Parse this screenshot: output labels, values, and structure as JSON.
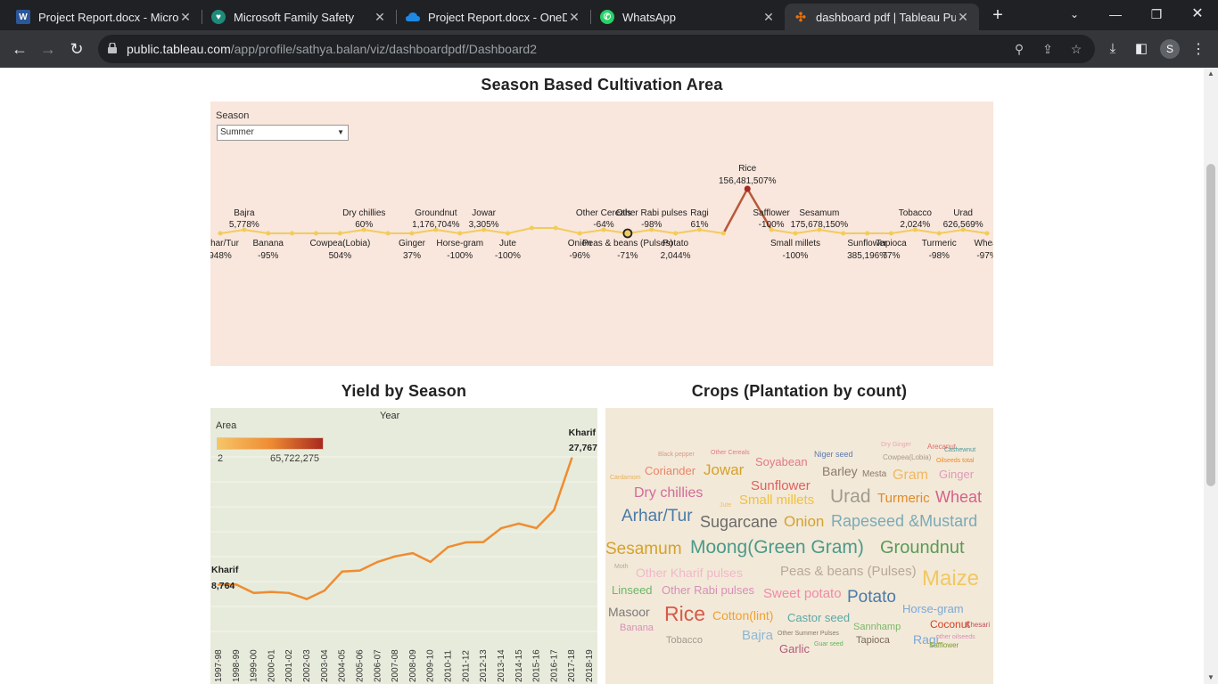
{
  "browser": {
    "tabs": [
      {
        "title": "Project Report.docx - Micros",
        "icon": "word-icon"
      },
      {
        "title": "Microsoft Family Safety",
        "icon": "family-safety-icon"
      },
      {
        "title": "Project Report.docx - OneDr",
        "icon": "onedrive-icon"
      },
      {
        "title": "WhatsApp",
        "icon": "whatsapp-icon"
      },
      {
        "title": "dashboard pdf | Tableau Pub",
        "icon": "tableau-icon",
        "active": true
      }
    ],
    "url_host": "public.tableau.com",
    "url_path": "/app/profile/sathya.balan/viz/dashboardpdf/Dashboard2",
    "profile_initial": "S"
  },
  "dashboard": {
    "season_title": "Season Based Cultivation Area",
    "season_filter_label": "Season",
    "season_filter_value": "Summer",
    "yield_title": "Yield by Season",
    "crops_title": "Crops (Plantation by count)",
    "yield_area_label": "Area",
    "yield_year_label": "Year",
    "yield_area_min": "2",
    "yield_area_max": "65,722,275"
  },
  "chart_data": [
    {
      "type": "line",
      "title": "Season Based Cultivation Area",
      "filter": "Summer",
      "points": [
        {
          "crop": "Arhar/Tur",
          "value": "948%",
          "pos": "below"
        },
        {
          "crop": "Bajra",
          "value": "5,778%",
          "pos": "above"
        },
        {
          "crop": "Banana",
          "value": "-95%",
          "pos": "below"
        },
        {
          "crop": "",
          "value": ""
        },
        {
          "crop": "",
          "value": ""
        },
        {
          "crop": "Cowpea(Lobia)",
          "value": "504%",
          "pos": "below"
        },
        {
          "crop": "Dry chillies",
          "value": "60%",
          "pos": "above"
        },
        {
          "crop": "",
          "value": ""
        },
        {
          "crop": "Ginger",
          "value": "37%",
          "pos": "below"
        },
        {
          "crop": "Groundnut",
          "value": "1,176,704%",
          "pos": "above"
        },
        {
          "crop": "Horse-gram",
          "value": "-100%",
          "pos": "below"
        },
        {
          "crop": "Jowar",
          "value": "3,305%",
          "pos": "above"
        },
        {
          "crop": "Jute",
          "value": "-100%",
          "pos": "below"
        },
        {
          "crop": "",
          "value": ""
        },
        {
          "crop": "",
          "value": ""
        },
        {
          "crop": "Onion",
          "value": "-96%",
          "pos": "below"
        },
        {
          "crop": "Other Cereals",
          "value": "-64%",
          "pos": "above"
        },
        {
          "crop": "Peas & beans (Pulses)",
          "value": "-71%",
          "pos": "below"
        },
        {
          "crop": "Other Rabi pulses",
          "value": "-98%",
          "pos": "above"
        },
        {
          "crop": "Potato",
          "value": "2,044%",
          "pos": "below"
        },
        {
          "crop": "Ragi",
          "value": "61%",
          "pos": "above"
        },
        {
          "crop": "",
          "value": ""
        },
        {
          "crop": "Rice",
          "value": "156,481,507%",
          "pos": "peak"
        },
        {
          "crop": "Safflower",
          "value": "-100%",
          "pos": "above"
        },
        {
          "crop": "Small millets",
          "value": "-100%",
          "pos": "below"
        },
        {
          "crop": "Sesamum",
          "value": "175,678,150%",
          "pos": "above"
        },
        {
          "crop": "",
          "value": ""
        },
        {
          "crop": "Sunflower",
          "value": "385,196%",
          "pos": "below"
        },
        {
          "crop": "Tapioca",
          "value": "77%",
          "pos": "below"
        },
        {
          "crop": "Tobacco",
          "value": "2,024%",
          "pos": "above"
        },
        {
          "crop": "Turmeric",
          "value": "-98%",
          "pos": "below"
        },
        {
          "crop": "Urad",
          "value": "626,569%",
          "pos": "above"
        },
        {
          "crop": "Wheat",
          "value": "-97%",
          "pos": "below"
        }
      ]
    },
    {
      "type": "line",
      "title": "Yield by Season",
      "x_label": "Year",
      "x": [
        "1997-98",
        "1998-99",
        "1999-00",
        "2000-01",
        "2001-02",
        "2002-03",
        "2003-04",
        "2004-05",
        "2005-06",
        "2006-07",
        "2007-08",
        "2008-09",
        "2009-10",
        "2010-11",
        "2011-12",
        "2012-13",
        "2013-14",
        "2014-15",
        "2015-16",
        "2016-17",
        "2017-18",
        "2018-19"
      ],
      "series": [
        {
          "name": "Kharif",
          "values": [
            8764,
            8798,
            7520,
            7680,
            7520,
            6610,
            7880,
            10750,
            10890,
            12180,
            13030,
            13510,
            12200,
            14430,
            15120,
            15180,
            17260,
            17950,
            17270,
            19990,
            27767
          ]
        }
      ],
      "start_label": "Kharif",
      "start_value": "8,764",
      "end_label": "Kharif",
      "end_value": "27,767",
      "ylim": [
        0,
        34000
      ],
      "color": "#ef8c32"
    }
  ],
  "word_cloud": [
    {
      "text": "Black pepper",
      "color": "#d89a8a"
    },
    {
      "text": "Other Cereals",
      "color": "#e07a8a"
    },
    {
      "text": "Niger seed",
      "color": "#5a7ab0"
    },
    {
      "text": "Dry Ginger",
      "color": "#e8a6b8"
    },
    {
      "text": "Arecanut",
      "color": "#d96c6c"
    },
    {
      "text": "Cashewnut",
      "color": "#4a9a9a"
    },
    {
      "text": "Coriander",
      "color": "#e8866a"
    },
    {
      "text": "Jowar",
      "color": "#d4a22c"
    },
    {
      "text": "Soyabean",
      "color": "#e07a8a"
    },
    {
      "text": "Barley",
      "color": "#8a7a6a"
    },
    {
      "text": "Mesta",
      "color": "#8a7a6a"
    },
    {
      "text": "Cowpea(Lobia)",
      "color": "#a89a8a"
    },
    {
      "text": "Oilseeds total",
      "color": "#f08a20"
    },
    {
      "text": "Cardamom",
      "color": "#e8b05a"
    },
    {
      "text": "Sunflower",
      "color": "#e06060"
    },
    {
      "text": "Gram",
      "color": "#f0b860"
    },
    {
      "text": "Ginger",
      "color": "#e09ab8"
    },
    {
      "text": "Dry chillies",
      "color": "#d36a9c"
    },
    {
      "text": "Jute",
      "color": "#f0c060"
    },
    {
      "text": "Small millets",
      "color": "#f0c040"
    },
    {
      "text": "Urad",
      "color": "#a09a90"
    },
    {
      "text": "Turmeric",
      "color": "#e08a2a"
    },
    {
      "text": "Wheat",
      "color": "#d6608a"
    },
    {
      "text": "Arhar/Tur",
      "color": "#4a7aa8"
    },
    {
      "text": "Sugarcane",
      "color": "#6a6a6a"
    },
    {
      "text": "Onion",
      "color": "#d4a22c"
    },
    {
      "text": "Rapeseed &Mustard",
      "color": "#7aaab8"
    },
    {
      "text": "Sesamum",
      "color": "#d4a22c"
    },
    {
      "text": "Moong(Green Gram)",
      "color": "#4a9a8a"
    },
    {
      "text": "Groundnut",
      "color": "#5a9a5a"
    },
    {
      "text": "Moth",
      "color": "#b8a89a"
    },
    {
      "text": "Other Kharif pulses",
      "color": "#f0b8c8"
    },
    {
      "text": "Peas & beans (Pulses)",
      "color": "#b8a89a"
    },
    {
      "text": "Maize",
      "color": "#f0c860"
    },
    {
      "text": "Linseed",
      "color": "#6ab86a"
    },
    {
      "text": "Other Rabi pulses",
      "color": "#d690b8"
    },
    {
      "text": "Sweet potato",
      "color": "#f08aa8"
    },
    {
      "text": "Potato",
      "color": "#4a7aa8"
    },
    {
      "text": "Masoor",
      "color": "#7a7a7a"
    },
    {
      "text": "Rice",
      "color": "#d65a4a"
    },
    {
      "text": "Cotton(lint)",
      "color": "#f0a030"
    },
    {
      "text": "Castor seed",
      "color": "#5aa8a8"
    },
    {
      "text": "Horse-gram",
      "color": "#7aa8d8"
    },
    {
      "text": "Coconut",
      "color": "#d6402a"
    },
    {
      "text": "Khesari",
      "color": "#c0505a"
    },
    {
      "text": "Sannhamp",
      "color": "#7ab86a"
    },
    {
      "text": "Banana",
      "color": "#d690b8"
    },
    {
      "text": "Bajra",
      "color": "#8ab8d8"
    },
    {
      "text": "Other Summer Pulses",
      "color": "#8a7a6a"
    },
    {
      "text": "other oilseeds",
      "color": "#d690b8"
    },
    {
      "text": "Tobacco",
      "color": "#a09a90"
    },
    {
      "text": "Guar seed",
      "color": "#5ab85a"
    },
    {
      "text": "Tapioca",
      "color": "#7a6a5a"
    },
    {
      "text": "Ragi",
      "color": "#7aa8d8"
    },
    {
      "text": "Safflower",
      "color": "#7a9a2a"
    },
    {
      "text": "Garlic",
      "color": "#b05a7a"
    }
  ]
}
